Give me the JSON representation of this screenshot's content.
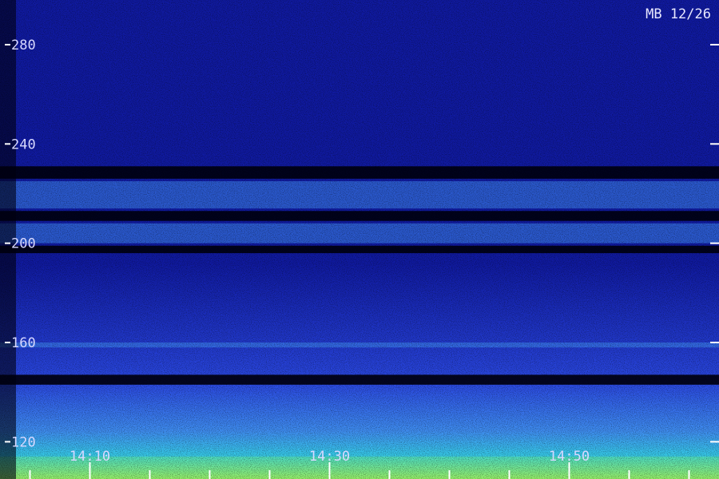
{
  "chart_data": {
    "type": "heatmap",
    "title": "MB 12/26",
    "xlabel": "",
    "ylabel": "",
    "x_tick_labels": [
      "14:10",
      "14:30",
      "14:50"
    ],
    "x_tick_minutes": [
      10,
      30,
      50
    ],
    "xlim_minutes": [
      2.5,
      62.5
    ],
    "minor_tick_interval_minutes": 5,
    "y_ticks": [
      120,
      160,
      200,
      240,
      280
    ],
    "ylim": [
      105,
      298
    ],
    "colormap": [
      "#000010",
      "#101aa0",
      "#2a48e0",
      "#3f8df0",
      "#36c8e8",
      "#5ef0a0",
      "#c8f03c"
    ],
    "dark_bands": [
      [
        196,
        199
      ],
      [
        209,
        213
      ],
      [
        226,
        231
      ],
      [
        143,
        147
      ]
    ],
    "bright_bands": [
      [
        214,
        225
      ],
      [
        200,
        208
      ],
      [
        158,
        160
      ]
    ],
    "bright_floor_below": 114,
    "grid": false,
    "legend": "none"
  }
}
